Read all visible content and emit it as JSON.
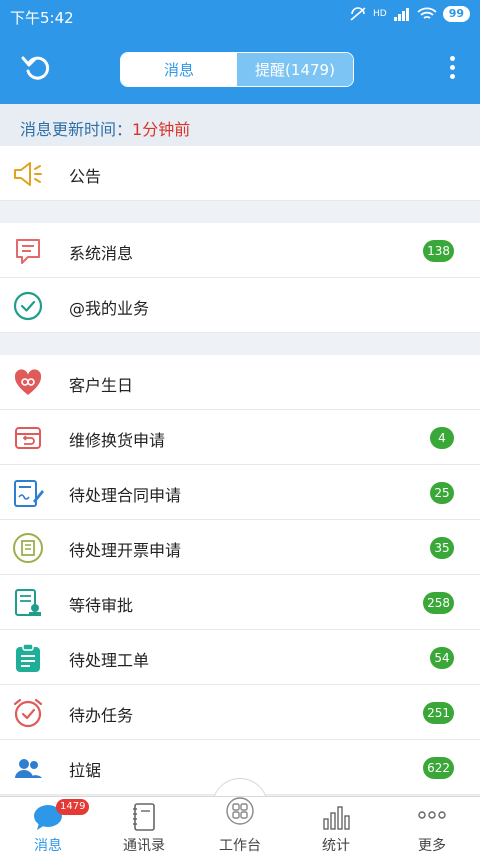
{
  "status": {
    "time": "下午5:42",
    "battery": "99",
    "network": "HD"
  },
  "header": {
    "tabs": [
      "消息",
      "提醒(1479)"
    ],
    "update_label": "消息更新时间：",
    "update_value": "1分钟前"
  },
  "sections": [
    {
      "items": [
        {
          "label": "公告",
          "icon": "megaphone-icon",
          "badge": ""
        }
      ]
    },
    {
      "items": [
        {
          "label": "系统消息",
          "icon": "chat-bubble-icon",
          "badge": "138"
        },
        {
          "label": "@我的业务",
          "icon": "check-circle-icon",
          "badge": ""
        }
      ]
    },
    {
      "items": [
        {
          "label": "客户生日",
          "icon": "heart-icon",
          "badge": ""
        },
        {
          "label": "维修换货申请",
          "icon": "repair-box-icon",
          "badge": "4"
        },
        {
          "label": "待处理合同申请",
          "icon": "contract-pen-icon",
          "badge": "25"
        },
        {
          "label": "待处理开票申请",
          "icon": "invoice-icon",
          "badge": "35"
        },
        {
          "label": "等待审批",
          "icon": "approval-doc-icon",
          "badge": "258"
        },
        {
          "label": "待处理工单",
          "icon": "clipboard-icon",
          "badge": "54"
        },
        {
          "label": "待办任务",
          "icon": "alarm-clock-icon",
          "badge": "251"
        },
        {
          "label": "拉锯",
          "icon": "people-icon",
          "badge": "622"
        }
      ]
    }
  ],
  "tabbar": {
    "items": [
      {
        "label": "消息",
        "badge": "1479",
        "icon": "chat-icon"
      },
      {
        "label": "通讯录",
        "icon": "contacts-book-icon"
      },
      {
        "label": "工作台",
        "icon": "grid-apps-icon"
      },
      {
        "label": "统计",
        "icon": "bar-chart-icon"
      },
      {
        "label": "更多",
        "icon": "more-dots-icon"
      }
    ]
  },
  "colors": {
    "primary": "#2f97e8",
    "badge_green": "#3aa839",
    "alert_red": "#d9332b"
  }
}
